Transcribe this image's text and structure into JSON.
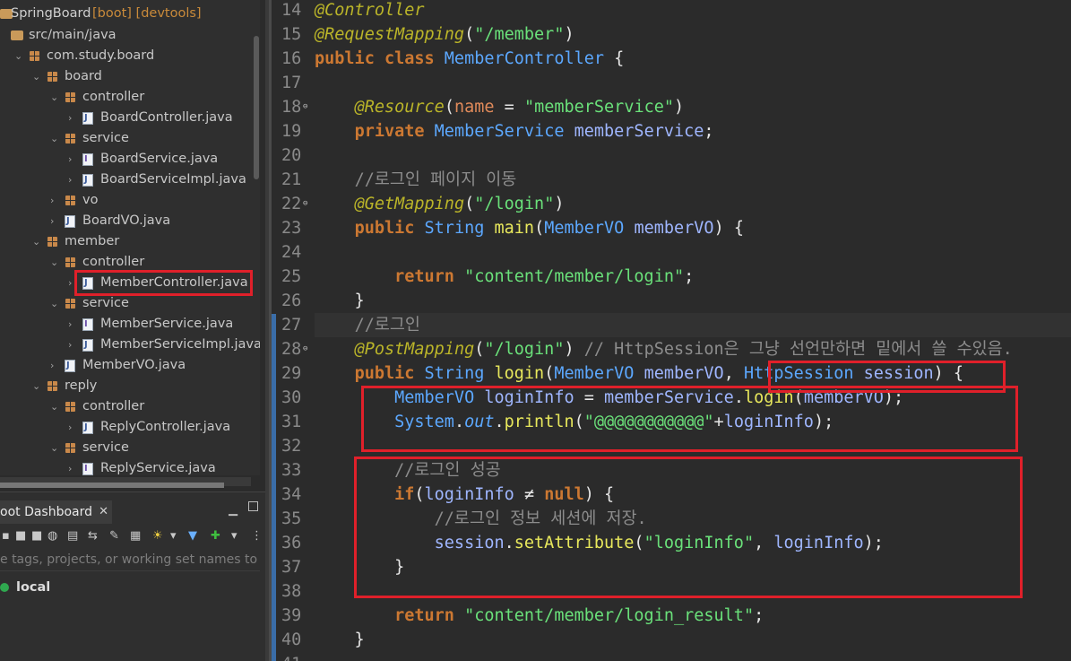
{
  "explorer": {
    "project": {
      "name": "SpringBoard",
      "tags": "[boot] [devtools]"
    },
    "tree": [
      {
        "label": "src/main/java",
        "type": "root",
        "indent": 0
      },
      {
        "label": "com.study.board",
        "type": "pkg",
        "indent": 1
      },
      {
        "label": "board",
        "type": "pkg",
        "indent": 2
      },
      {
        "label": "controller",
        "type": "pkg",
        "indent": 3
      },
      {
        "label": "BoardController.java",
        "type": "java",
        "indent": 4
      },
      {
        "label": "service",
        "type": "pkg",
        "indent": 3
      },
      {
        "label": "BoardService.java",
        "type": "iface",
        "indent": 4
      },
      {
        "label": "BoardServiceImpl.java",
        "type": "java",
        "indent": 4
      },
      {
        "label": "vo",
        "type": "pkg",
        "indent": 3
      },
      {
        "label": "BoardVO.java",
        "type": "java",
        "indent": 3
      },
      {
        "label": "member",
        "type": "pkg",
        "indent": 2
      },
      {
        "label": "controller",
        "type": "pkg",
        "indent": 3
      },
      {
        "label": "MemberController.java",
        "type": "java",
        "indent": 4
      },
      {
        "label": "service",
        "type": "pkg",
        "indent": 3
      },
      {
        "label": "MemberService.java",
        "type": "iface",
        "indent": 4
      },
      {
        "label": "MemberServiceImpl.java",
        "type": "java",
        "indent": 4
      },
      {
        "label": "MemberVO.java",
        "type": "java",
        "indent": 3
      },
      {
        "label": "reply",
        "type": "pkg",
        "indent": 2
      },
      {
        "label": "controller",
        "type": "pkg",
        "indent": 3
      },
      {
        "label": "ReplyController.java",
        "type": "java",
        "indent": 4
      },
      {
        "label": "service",
        "type": "pkg",
        "indent": 3
      },
      {
        "label": "ReplyService.java",
        "type": "iface",
        "indent": 4
      }
    ]
  },
  "dashboard": {
    "tab_label": "oot Dashboard",
    "filter_placeholder": "e tags, projects, or working set names to m",
    "local_label": "local"
  },
  "editor": {
    "lines": [
      {
        "n": "14",
        "t": [
          [
            "a",
            "@Controller"
          ]
        ]
      },
      {
        "n": "15",
        "t": [
          [
            "a",
            "@RequestMapping"
          ],
          [
            "p",
            "("
          ],
          [
            "s",
            "\"/member\""
          ],
          [
            "p",
            ")"
          ]
        ]
      },
      {
        "n": "16",
        "t": [
          [
            "k",
            "public class "
          ],
          [
            "t",
            "MemberController"
          ],
          [
            "p",
            " {"
          ]
        ]
      },
      {
        "n": "17",
        "t": []
      },
      {
        "n": "18",
        "fold": true,
        "t": [
          [
            "p",
            "    "
          ],
          [
            "a",
            "@Resource"
          ],
          [
            "p",
            "("
          ],
          [
            "n",
            "name"
          ],
          [
            "p",
            " = "
          ],
          [
            "s",
            "\"memberService\""
          ],
          [
            "p",
            ")"
          ]
        ]
      },
      {
        "n": "19",
        "t": [
          [
            "p",
            "    "
          ],
          [
            "k",
            "private "
          ],
          [
            "t",
            "MemberService "
          ],
          [
            "v",
            "memberService"
          ],
          [
            "p",
            ";"
          ]
        ]
      },
      {
        "n": "20",
        "t": []
      },
      {
        "n": "21",
        "t": [
          [
            "p",
            "    "
          ],
          [
            "c",
            "//로그인 페이지 이동"
          ]
        ]
      },
      {
        "n": "22",
        "fold": true,
        "t": [
          [
            "p",
            "    "
          ],
          [
            "a",
            "@GetMapping"
          ],
          [
            "p",
            "("
          ],
          [
            "s",
            "\"/login\""
          ],
          [
            "p",
            ")"
          ]
        ]
      },
      {
        "n": "23",
        "t": [
          [
            "p",
            "    "
          ],
          [
            "k",
            "public "
          ],
          [
            "t",
            "String "
          ],
          [
            "f",
            "main"
          ],
          [
            "p",
            "("
          ],
          [
            "t",
            "MemberVO "
          ],
          [
            "v",
            "memberVO"
          ],
          [
            "p",
            ") {"
          ]
        ]
      },
      {
        "n": "24",
        "t": []
      },
      {
        "n": "25",
        "t": [
          [
            "p",
            "        "
          ],
          [
            "k",
            "return "
          ],
          [
            "s",
            "\"content/member/login\""
          ],
          [
            "p",
            ";"
          ]
        ]
      },
      {
        "n": "26",
        "t": [
          [
            "p",
            "    }"
          ]
        ]
      },
      {
        "n": "27",
        "hl": true,
        "t": [
          [
            "p",
            "    "
          ],
          [
            "c",
            "//로그인"
          ]
        ]
      },
      {
        "n": "28",
        "fold": true,
        "t": [
          [
            "p",
            "    "
          ],
          [
            "a",
            "@PostMapping"
          ],
          [
            "p",
            "("
          ],
          [
            "s",
            "\"/login\""
          ],
          [
            "p",
            ") "
          ],
          [
            "c",
            "// HttpSession은 그냥 선언만하면 밑에서 쓸 수있음."
          ]
        ]
      },
      {
        "n": "29",
        "t": [
          [
            "p",
            "    "
          ],
          [
            "k",
            "public "
          ],
          [
            "t",
            "String "
          ],
          [
            "f",
            "login"
          ],
          [
            "p",
            "("
          ],
          [
            "t",
            "MemberVO "
          ],
          [
            "v",
            "memberVO"
          ],
          [
            "p",
            ", "
          ],
          [
            "t",
            "HttpSession "
          ],
          [
            "v",
            "session"
          ],
          [
            "p",
            ") {"
          ]
        ]
      },
      {
        "n": "30",
        "t": [
          [
            "p",
            "        "
          ],
          [
            "t",
            "MemberVO "
          ],
          [
            "v",
            "loginInfo"
          ],
          [
            "p",
            " = "
          ],
          [
            "v",
            "memberService"
          ],
          [
            "p",
            "."
          ],
          [
            "f",
            "login"
          ],
          [
            "p",
            "("
          ],
          [
            "v",
            "memberVO"
          ],
          [
            "p",
            ");"
          ]
        ]
      },
      {
        "n": "31",
        "t": [
          [
            "p",
            "        "
          ],
          [
            "t",
            "System"
          ],
          [
            "p",
            "."
          ],
          [
            "o",
            "out"
          ],
          [
            "p",
            "."
          ],
          [
            "f",
            "println"
          ],
          [
            "p",
            "("
          ],
          [
            "s",
            "\"@@@@@@@@@@@\""
          ],
          [
            "p",
            "+"
          ],
          [
            "v",
            "loginInfo"
          ],
          [
            "p",
            ");"
          ]
        ]
      },
      {
        "n": "32",
        "t": []
      },
      {
        "n": "33",
        "t": [
          [
            "p",
            "        "
          ],
          [
            "c",
            "//로그인 성공"
          ]
        ]
      },
      {
        "n": "34",
        "t": [
          [
            "p",
            "        "
          ],
          [
            "k",
            "if"
          ],
          [
            "p",
            "("
          ],
          [
            "v",
            "loginInfo"
          ],
          [
            "p",
            " ≠ "
          ],
          [
            "k",
            "null"
          ],
          [
            "p",
            ") {"
          ]
        ]
      },
      {
        "n": "35",
        "t": [
          [
            "p",
            "            "
          ],
          [
            "c",
            "//로그인 정보 세션에 저장."
          ]
        ]
      },
      {
        "n": "36",
        "t": [
          [
            "p",
            "            "
          ],
          [
            "v",
            "session"
          ],
          [
            "p",
            "."
          ],
          [
            "f",
            "setAttribute"
          ],
          [
            "p",
            "("
          ],
          [
            "s",
            "\"loginInfo\""
          ],
          [
            "p",
            ", "
          ],
          [
            "v",
            "loginInfo"
          ],
          [
            "p",
            ");"
          ]
        ]
      },
      {
        "n": "37",
        "t": [
          [
            "p",
            "        }"
          ]
        ]
      },
      {
        "n": "38",
        "t": []
      },
      {
        "n": "39",
        "t": [
          [
            "p",
            "        "
          ],
          [
            "k",
            "return "
          ],
          [
            "s",
            "\"content/member/login_result\""
          ],
          [
            "p",
            ";"
          ]
        ]
      },
      {
        "n": "40",
        "t": [
          [
            "p",
            "    }"
          ]
        ]
      },
      {
        "n": "41",
        "t": []
      }
    ]
  }
}
